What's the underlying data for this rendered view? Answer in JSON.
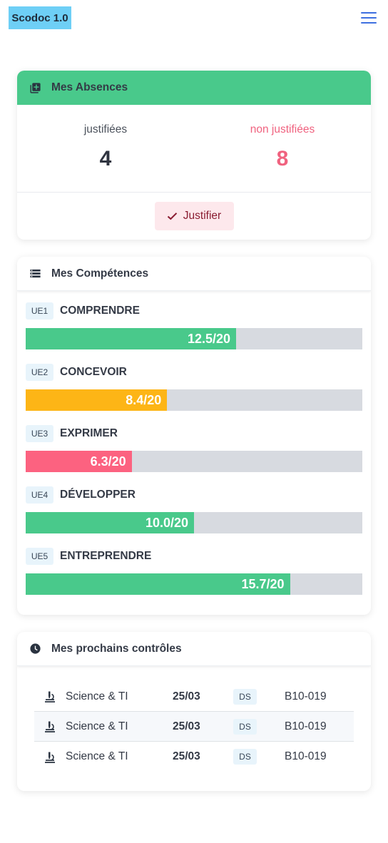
{
  "app": {
    "title": "Scodoc 1.0",
    "menu_icon": "hamburger-menu-icon",
    "accent": "#3d6fe0"
  },
  "absences": {
    "title": "Mes Absences",
    "icon": "add-box-icon",
    "header_color": "#49c98b",
    "justified_label": "justifiées",
    "justified_count": "4",
    "unjustified_label": "non justifiées",
    "unjustified_count": "8",
    "button_label": "Justifier",
    "button_icon": "check-icon"
  },
  "competences": {
    "title": "Mes Compétences",
    "icon": "storage-icon",
    "items": [
      {
        "tag": "UE1",
        "name": "COMPRENDRE",
        "score": "12.5/20",
        "value": 12.5,
        "max": 20,
        "color": "#49c98b"
      },
      {
        "tag": "UE2",
        "name": "CONCEVOIR",
        "score": "8.4/20",
        "value": 8.4,
        "max": 20,
        "color": "#fdb516"
      },
      {
        "tag": "UE3",
        "name": "EXPRIMER",
        "score": "6.3/20",
        "value": 6.3,
        "max": 20,
        "color": "#fc6280"
      },
      {
        "tag": "UE4",
        "name": "DÉVELOPPER",
        "score": "10.0/20",
        "value": 10.0,
        "max": 20,
        "color": "#49c98b"
      },
      {
        "tag": "UE5",
        "name": "ENTREPRENDRE",
        "score": "15.7/20",
        "value": 15.7,
        "max": 20,
        "color": "#49c98b"
      }
    ]
  },
  "controles": {
    "title": "Mes prochains contrôles",
    "icon": "clock-icon",
    "rows": [
      {
        "icon": "microscope-icon",
        "subject": "Science & TI",
        "date": "25/03",
        "type": "DS",
        "room": "B10-019"
      },
      {
        "icon": "microscope-icon",
        "subject": "Science & TI",
        "date": "25/03",
        "type": "DS",
        "room": "B10-019"
      },
      {
        "icon": "microscope-icon",
        "subject": "Science & TI",
        "date": "25/03",
        "type": "DS",
        "room": "B10-019"
      }
    ]
  }
}
